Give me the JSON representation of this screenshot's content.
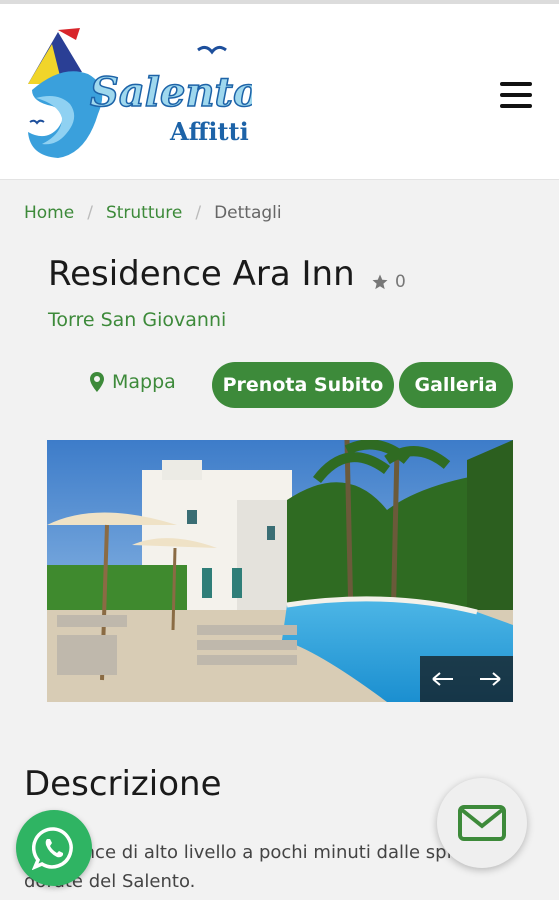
{
  "header": {
    "logo_text": "Salento",
    "logo_subtext": "Affitti",
    "menu_icon": "hamburger-menu-icon"
  },
  "breadcrumb": {
    "items": [
      "Home",
      "Strutture"
    ],
    "current": "Dettagli",
    "separator": "/"
  },
  "property": {
    "name": "Residence Ara Inn",
    "rating_count": "0",
    "location": "Torre San Giovanni"
  },
  "actions": {
    "map_label": "Mappa",
    "book_label": "Prenota Subito",
    "gallery_label": "Galleria"
  },
  "carousel": {
    "prev_icon": "arrow-left-icon",
    "next_icon": "arrow-right-icon"
  },
  "description": {
    "title": "Descrizione",
    "line1": "Residence di alto livello a pochi minuti dalle spiagge",
    "line2": "dorate del Salento."
  },
  "colors": {
    "accent": "#3d8a3a",
    "whatsapp": "#2fb463"
  }
}
